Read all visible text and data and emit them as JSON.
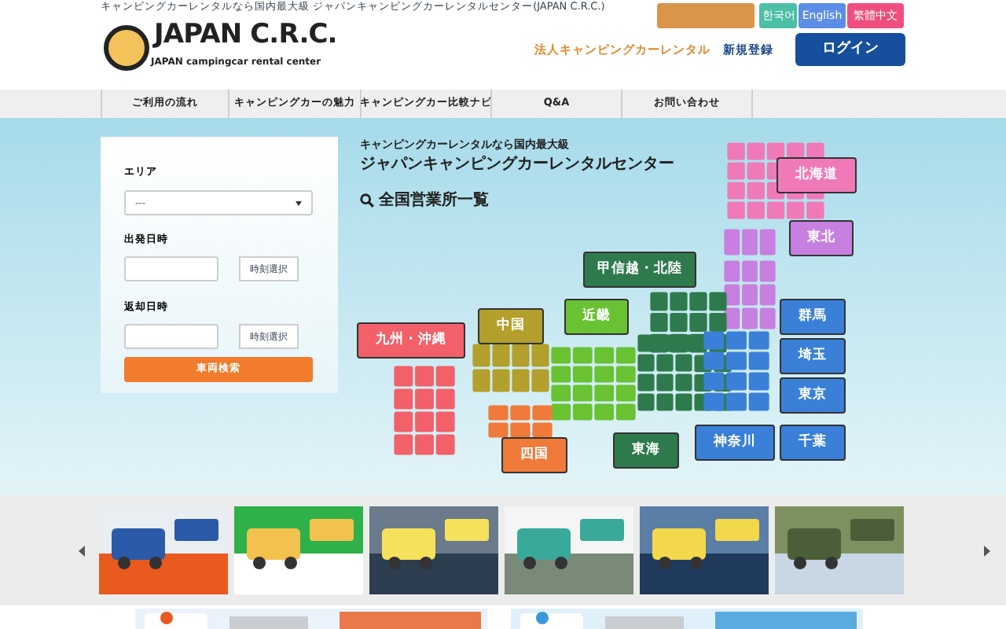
{
  "header": {
    "tagline": "キャンピングカーレンタルなら国内最大級 ジャパンキャンピングカーレンタルセンター(JAPAN C.R.C.)",
    "logo": {
      "title": "JAPAN C.R.C.",
      "subtitle": "JAPAN campingcar rental center"
    },
    "languages": [
      {
        "color": "#d9954a"
      },
      {
        "label": "한국어",
        "color": "#4cbfa6"
      },
      {
        "label": "English",
        "color": "#5b8ee6"
      },
      {
        "label": "繁體中文",
        "color": "#ee4f7e"
      }
    ],
    "links": [
      {
        "label": "法人キャンピングカーレンタル",
        "kind": "corporate"
      },
      {
        "label": "新規登録",
        "kind": "register"
      },
      {
        "label": "ログイン",
        "kind": "login"
      }
    ]
  },
  "nav": [
    "ご利用の流れ",
    "キャンピングカーの魅力",
    "キャンピングカー比較ナビ",
    "Q&A",
    "お問い合わせ"
  ],
  "search_form": {
    "area_label": "エリア",
    "area_value": "---",
    "departure_label": "出発日時",
    "departure_button": "時刻選択",
    "return_label": "返却日時",
    "return_button": "時刻選択",
    "submit": "車両検索"
  },
  "hero": {
    "subtitle": "キャンピングカーレンタルなら国内最大級",
    "title": "ジャパンキャンピングカーレンタルセンター",
    "map_heading": "全国営業所一覧"
  },
  "regions": [
    {
      "label": "北海道",
      "color": "#f07ab8"
    },
    {
      "label": "東北",
      "color": "#c77fe0"
    },
    {
      "label": "甲信越・北陸",
      "color": "#2f7a4c"
    },
    {
      "label": "近畿",
      "color": "#68c232"
    },
    {
      "label": "中国",
      "color": "#b3a02c"
    },
    {
      "label": "九州・沖縄",
      "color": "#f2606a"
    },
    {
      "label": "群馬",
      "color": "#3a80d8"
    },
    {
      "label": "埼玉",
      "color": "#3a80d8"
    },
    {
      "label": "東京",
      "color": "#3a80d8"
    },
    {
      "label": "神奈川",
      "color": "#3a80d8"
    },
    {
      "label": "千葉",
      "color": "#3a80d8"
    },
    {
      "label": "東海",
      "color": "#2f7a4c"
    },
    {
      "label": "四国",
      "color": "#f07a3a"
    }
  ]
}
